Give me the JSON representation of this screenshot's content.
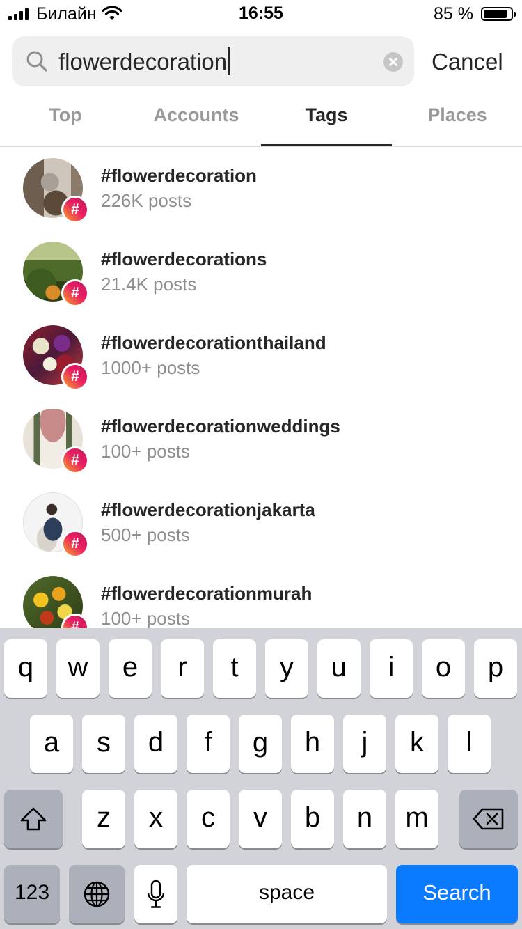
{
  "status_bar": {
    "carrier": "Билайн",
    "time": "16:55",
    "battery": "85 %"
  },
  "search": {
    "query": "flowerdecoration",
    "cancel_label": "Cancel"
  },
  "tabs": [
    {
      "label": "Top"
    },
    {
      "label": "Accounts"
    },
    {
      "label": "Tags"
    },
    {
      "label": "Places"
    }
  ],
  "active_tab": "Tags",
  "results": [
    {
      "tag": "#flowerdecoration",
      "posts": "226K posts"
    },
    {
      "tag": "#flowerdecorations",
      "posts": "21.4K posts"
    },
    {
      "tag": "#flowerdecorationthailand",
      "posts": "1000+ posts"
    },
    {
      "tag": "#flowerdecorationweddings",
      "posts": "100+ posts"
    },
    {
      "tag": "#flowerdecorationjakarta",
      "posts": "500+ posts"
    },
    {
      "tag": "#flowerdecorationmurah",
      "posts": "100+ posts"
    }
  ],
  "badge_symbol": "#",
  "keyboard": {
    "row1": [
      "q",
      "w",
      "e",
      "r",
      "t",
      "y",
      "u",
      "i",
      "o",
      "p"
    ],
    "row2": [
      "a",
      "s",
      "d",
      "f",
      "g",
      "h",
      "j",
      "k",
      "l"
    ],
    "row3": [
      "z",
      "x",
      "c",
      "v",
      "b",
      "n",
      "m"
    ],
    "numbers_label": "123",
    "space_label": "space",
    "search_label": "Search"
  },
  "colors": {
    "accent": "#0a7afe",
    "muted_text": "#8e8e8e",
    "keyboard_bg": "#d1d3d9"
  }
}
